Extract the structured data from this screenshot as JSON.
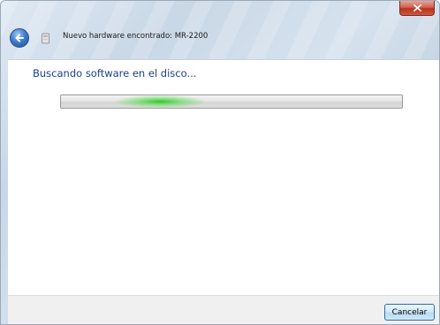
{
  "window": {
    "title": "Nuevo hardware encontrado: MR-2200",
    "close_icon": "close-icon",
    "back_icon": "back-arrow-icon",
    "device_icon": "hardware-device-icon"
  },
  "content": {
    "heading": "Buscando software en el disco...",
    "progress": {
      "type": "indeterminate",
      "glow_position_fraction": 0.25,
      "glow_color": "#2ec82e"
    }
  },
  "footer": {
    "cancel_label": "Cancelar"
  },
  "colors": {
    "heading": "#1e3f8a",
    "close_button": "#c8452f",
    "back_button": "#3f7fd0"
  }
}
